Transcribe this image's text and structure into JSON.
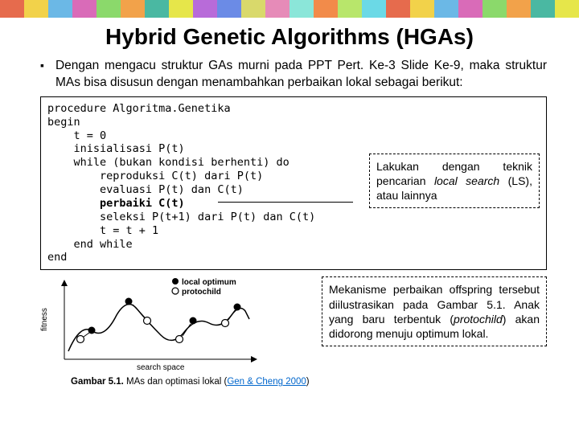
{
  "title": "Hybrid Genetic Algorithms (HGAs)",
  "bullet": "Dengan mengacu struktur GAs murni pada PPT Pert. Ke-3 Slide Ke-9, maka struktur MAs bisa disusun dengan menambahkan perbaikan lokal sebagai berikut:",
  "code": {
    "l1": "procedure Algoritma.Genetika",
    "l2": "begin",
    "l3": "    t = 0",
    "l4": "    inisialisasi P(t)",
    "l5": "    while (bukan kondisi berhenti) do",
    "l6": "        reproduksi C(t) dari P(t)",
    "l7": "        evaluasi P(t) dan C(t)",
    "l8b": "        perbaiki C(t)",
    "l9": "        seleksi P(t+1) dari P(t) dan C(t)",
    "l10": "        t = t + 1",
    "l11": "    end while",
    "l12": "end"
  },
  "annotation": {
    "t1": "Lakukan dengan teknik pencarian ",
    "t2": "local search",
    "t3": " (LS), atau lainnya"
  },
  "chart": {
    "ylabel": "fitness",
    "xlabel": "search space",
    "legend1": "local optimum",
    "legend2": "protochild"
  },
  "note": {
    "t1": "Mekanisme perbaikan offspring tersebut diilustrasikan pada Gambar 5.1. Anak yang baru terbentuk (",
    "t2": "protochild",
    "t3": ") akan didorong menuju optimum lokal."
  },
  "caption": {
    "label": "Gambar 5.1.",
    "desc": "  MAs dan optimasi lokal (",
    "link": "Gen & Cheng 2000",
    "close": ")"
  },
  "colors": [
    "#e66b4d",
    "#f2d24a",
    "#6bb8e6",
    "#d96bb8",
    "#8bd96b",
    "#f2a24a",
    "#4ab8a2",
    "#e6e64a",
    "#b86bd9",
    "#6b8be6",
    "#d9d96b",
    "#e68bb8",
    "#8be6d9",
    "#f28b4a",
    "#b8e66b",
    "#6bd9e6"
  ]
}
